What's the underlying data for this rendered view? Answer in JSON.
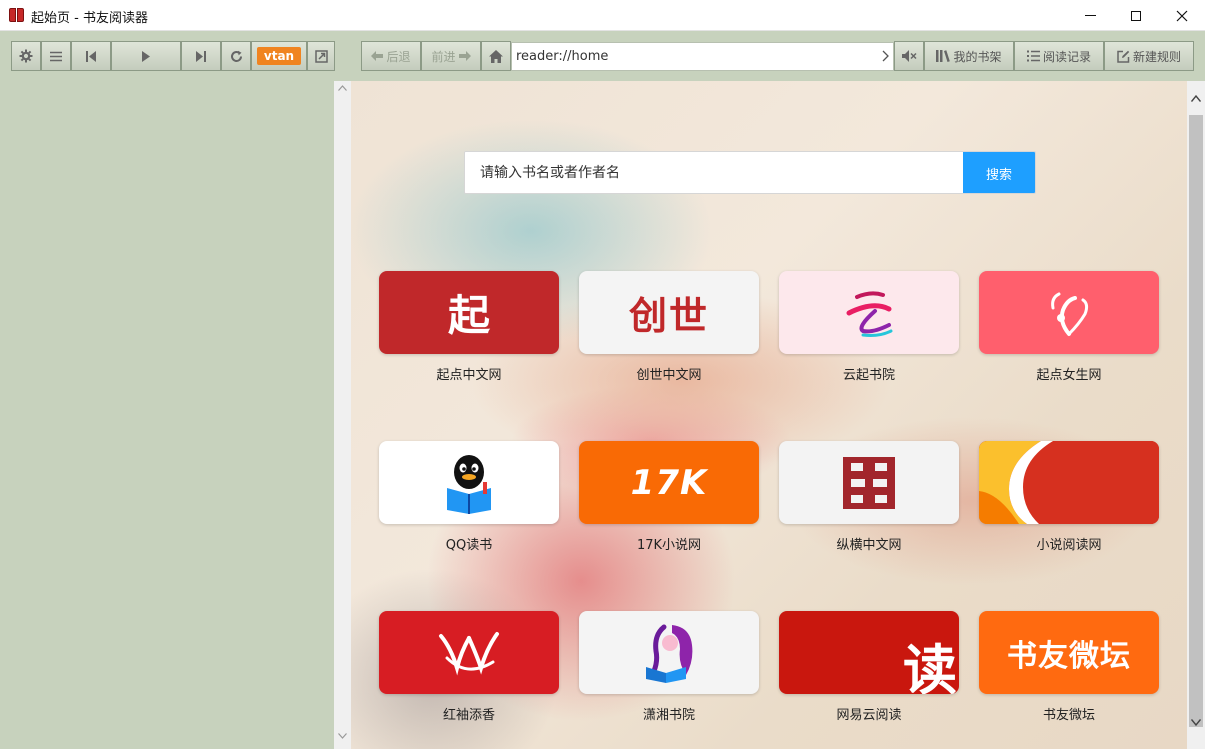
{
  "window": {
    "title": "起始页 - 书友阅读器"
  },
  "toolbar": {
    "vtan_label": "vtan",
    "back_label": "后退",
    "forward_label": "前进",
    "bookshelf_label": "我的书架",
    "history_label": "阅读记录",
    "new_rule_label": "新建规则"
  },
  "address": {
    "url": "reader://home"
  },
  "search": {
    "placeholder": "请输入书名或者作者名",
    "button_label": "搜索"
  },
  "sites": [
    {
      "label": "起点中文网",
      "logo_text": "起",
      "color": "#c0282a"
    },
    {
      "label": "创世中文网",
      "logo_text": "创世",
      "color": "#f4f4f4"
    },
    {
      "label": "云起书院",
      "logo_text": "云",
      "color": "#fde8ec"
    },
    {
      "label": "起点女生网",
      "logo_text": "",
      "color": "#ff5f6d"
    },
    {
      "label": "QQ读书",
      "logo_text": "",
      "color": "#ffffff"
    },
    {
      "label": "17K小说网",
      "logo_text": "17K",
      "color": "#f96a05"
    },
    {
      "label": "纵横中文网",
      "logo_text": "",
      "color": "#f3f3f3"
    },
    {
      "label": "小说阅读网",
      "logo_text": "",
      "color": "#d6301f"
    },
    {
      "label": "红袖添香",
      "logo_text": "",
      "color": "#d71d23"
    },
    {
      "label": "潇湘书院",
      "logo_text": "",
      "color": "#f4f4f4"
    },
    {
      "label": "网易云阅读",
      "logo_text": "读",
      "color": "#c9170e"
    },
    {
      "label": "书友微坛",
      "logo_text": "书友微坛",
      "color": "#ff6a10"
    }
  ]
}
